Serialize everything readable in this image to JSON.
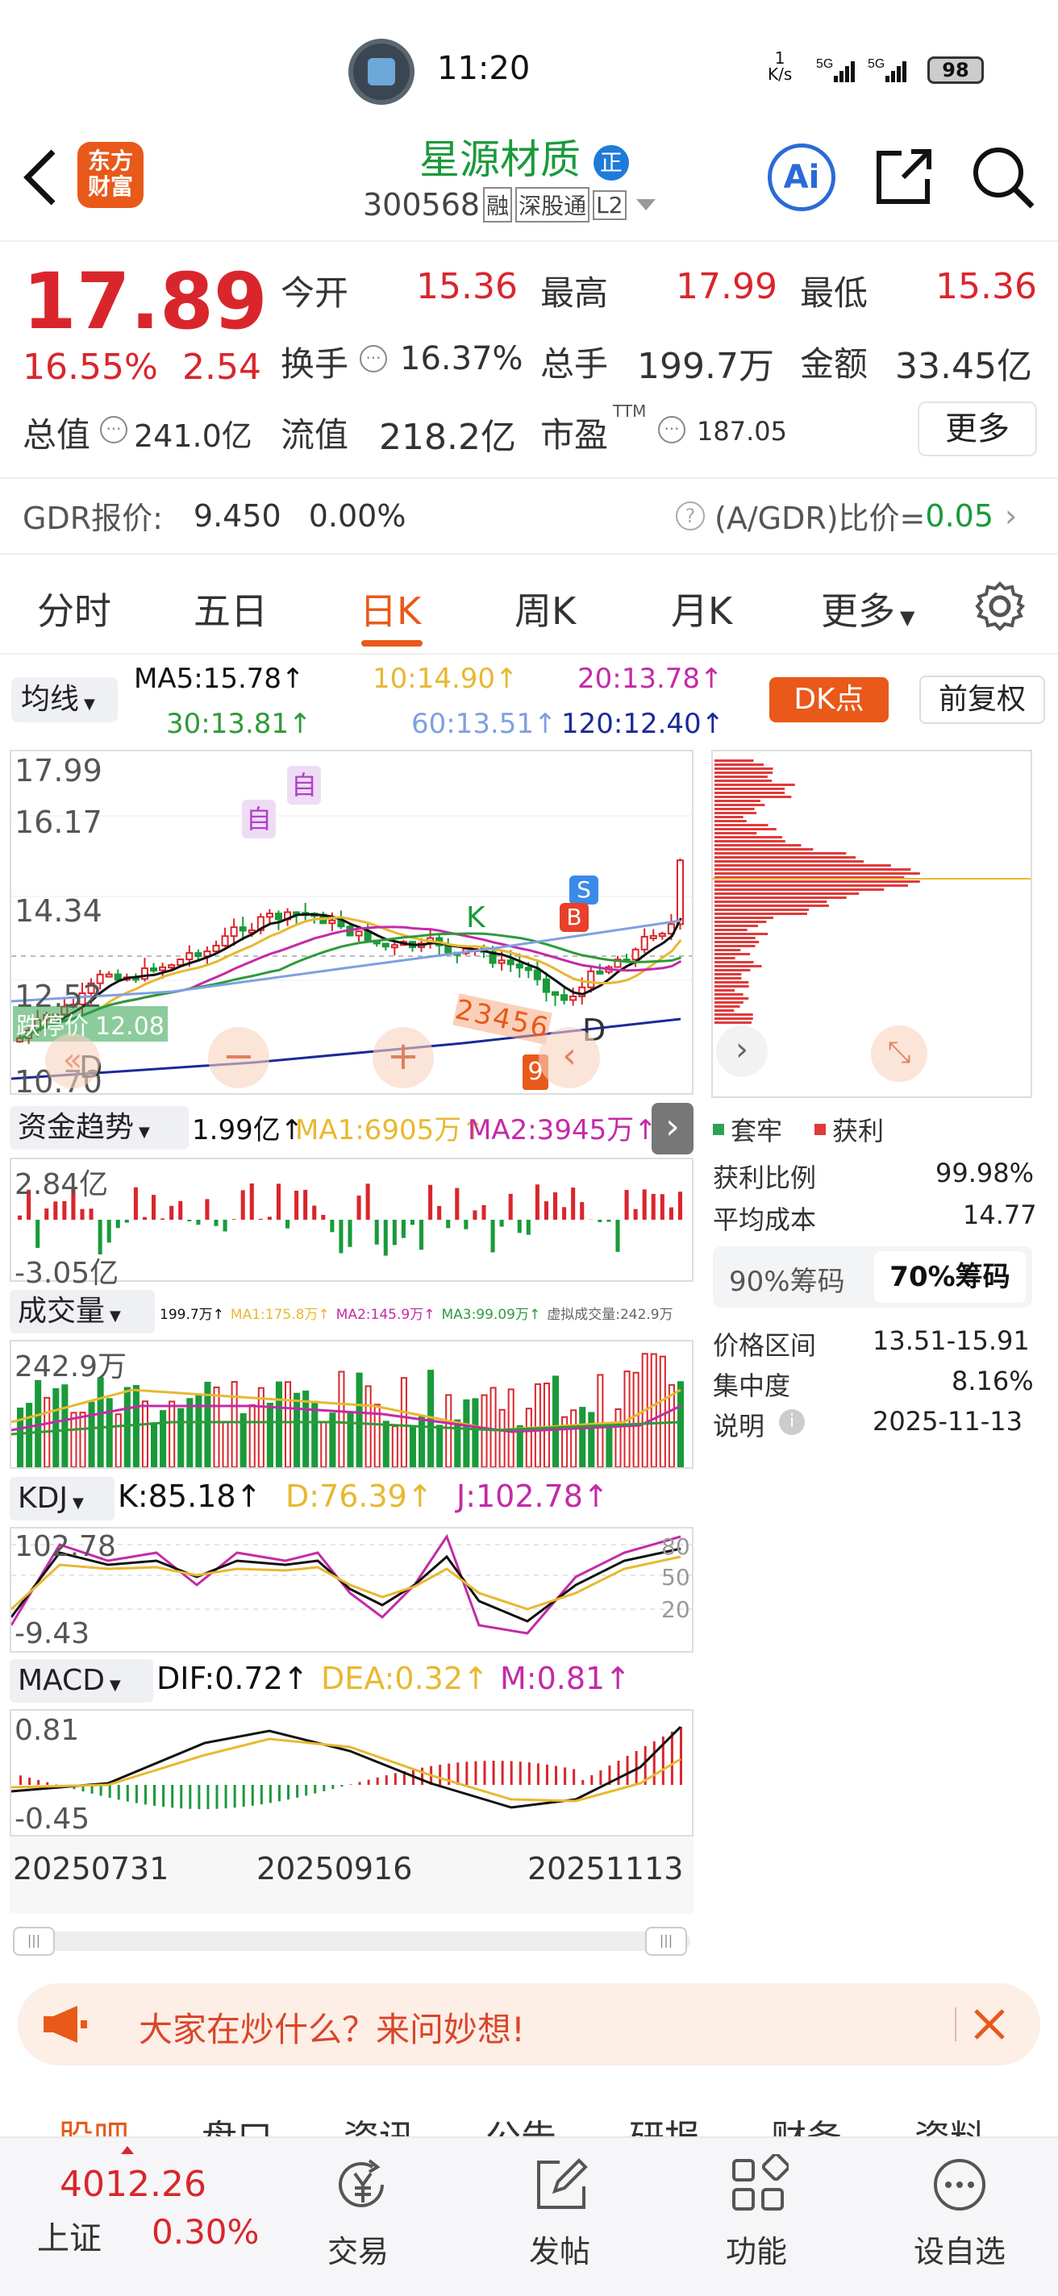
{
  "status_bar": {
    "time": "11:20",
    "net_speed_top": "1",
    "net_speed_bottom": "K/s",
    "signal1": "5G",
    "signal2": "5G",
    "battery": "98"
  },
  "header": {
    "brand_line1": "东方",
    "brand_line2": "财富",
    "stock_name": "星源材质",
    "name_badge": "正",
    "code": "300568",
    "tag1": "融",
    "tag2": "深股通",
    "tag3": "L2",
    "ai_label": "Ai"
  },
  "quote": {
    "price": "17.89",
    "change_pct": "16.55%",
    "change_amt": "2.54",
    "open_label": "今开",
    "open": "15.36",
    "high_label": "最高",
    "high": "17.99",
    "low_label": "最低",
    "low": "15.36",
    "turnover_label": "换手",
    "turnover": "16.37%",
    "volume_label": "总手",
    "volume": "199.7万",
    "amount_label": "金额",
    "amount": "33.45亿",
    "mktcap_label": "总值",
    "mktcap": "241.0亿",
    "float_label": "流值",
    "float_val": "218.2亿",
    "pe_label": "市盈",
    "pe_sup": "TTM",
    "pe": "187.05",
    "more": "更多"
  },
  "gdr": {
    "label": "GDR报价:",
    "price": "9.450",
    "pct": "0.00%",
    "ratio_label": "(A/GDR)比价=",
    "ratio": "0.05"
  },
  "period_tabs": [
    "分时",
    "五日",
    "日K",
    "周K",
    "月K",
    "更多"
  ],
  "ma": {
    "selector": "均线",
    "ma5": "MA5:15.78↑",
    "ma10": "10:14.90↑",
    "ma20": "20:13.78↑",
    "ma30": "30:13.81↑",
    "ma60": "60:13.51↑",
    "ma120": "120:12.40↑",
    "dk_btn": "DK点",
    "fq_btn": "前复权"
  },
  "kline": {
    "y_top": "17.99",
    "y2": "16.17",
    "y3": "14.34",
    "y4": "12.52",
    "y_bot": "10.70",
    "limit_label": "跌停价",
    "limit_value": "12.08",
    "auto1": "自",
    "auto2": "自",
    "k_mark": "K",
    "b_mark": "B",
    "s_mark": "S",
    "d_mark": "D",
    "d_mark2": "D",
    "seq_marks": "23456",
    "nine": "9"
  },
  "chips": {
    "legend_trap": "套牢",
    "legend_profit": "获利",
    "profit_ratio_label": "获利比例",
    "profit_ratio": "99.98%",
    "avg_cost_label": "平均成本",
    "avg_cost": "14.77",
    "tab90": "90%筹码",
    "tab70": "70%筹码",
    "range_label": "价格区间",
    "range": "13.51-15.91",
    "conc_label": "集中度",
    "conc": "8.16%",
    "note_label": "说明",
    "note_date": "2025-11-13"
  },
  "fund": {
    "selector": "资金趋势",
    "value": "1.99亿↑",
    "ma1": "MA1:6905万↑",
    "ma2": "MA2:3945万↑",
    "y_top": "2.84亿",
    "y_bot": "-3.05亿"
  },
  "vol": {
    "selector": "成交量",
    "v": "199.7万↑",
    "ma1": "MA1:175.8万↑",
    "ma2": "MA2:145.9万↑",
    "ma3": "MA3:99.09万↑",
    "virtual": "虚拟成交量:242.9万",
    "y_top": "242.9万"
  },
  "kdj": {
    "selector": "KDJ",
    "k": "K:85.18↑",
    "d": "D:76.39↑",
    "j": "J:102.78↑",
    "y_top": "102.78",
    "y_bot": "-9.43",
    "l80": "80",
    "l50": "50",
    "l20": "20"
  },
  "macd": {
    "selector": "MACD",
    "dif": "DIF:0.72↑",
    "dea": "DEA:0.32↑",
    "m": "M:0.81↑",
    "y_top": "0.81",
    "y_bot": "-0.45"
  },
  "dates": [
    "20250731",
    "20250916",
    "20251113"
  ],
  "banner": {
    "text": "大家在炒什么？来问妙想!"
  },
  "bottom_tabs": [
    "股吧",
    "盘口",
    "资讯",
    "公告",
    "研报",
    "财务",
    "资料"
  ],
  "bottom_nav": {
    "index_value": "4012.26",
    "index_name": "上证",
    "index_pct": "0.30%",
    "trade": "交易",
    "post": "发帖",
    "func": "功能",
    "watch": "设自选"
  },
  "colors": {
    "up": "#d9262c",
    "down": "#1a9a3a",
    "accent": "#e8591a",
    "ma5": "#111111",
    "ma10": "#e8b830",
    "ma20": "#c42aa8",
    "ma30": "#2e9a3a",
    "ma60": "#7fa0e0",
    "ma120": "#1a2a9a"
  }
}
